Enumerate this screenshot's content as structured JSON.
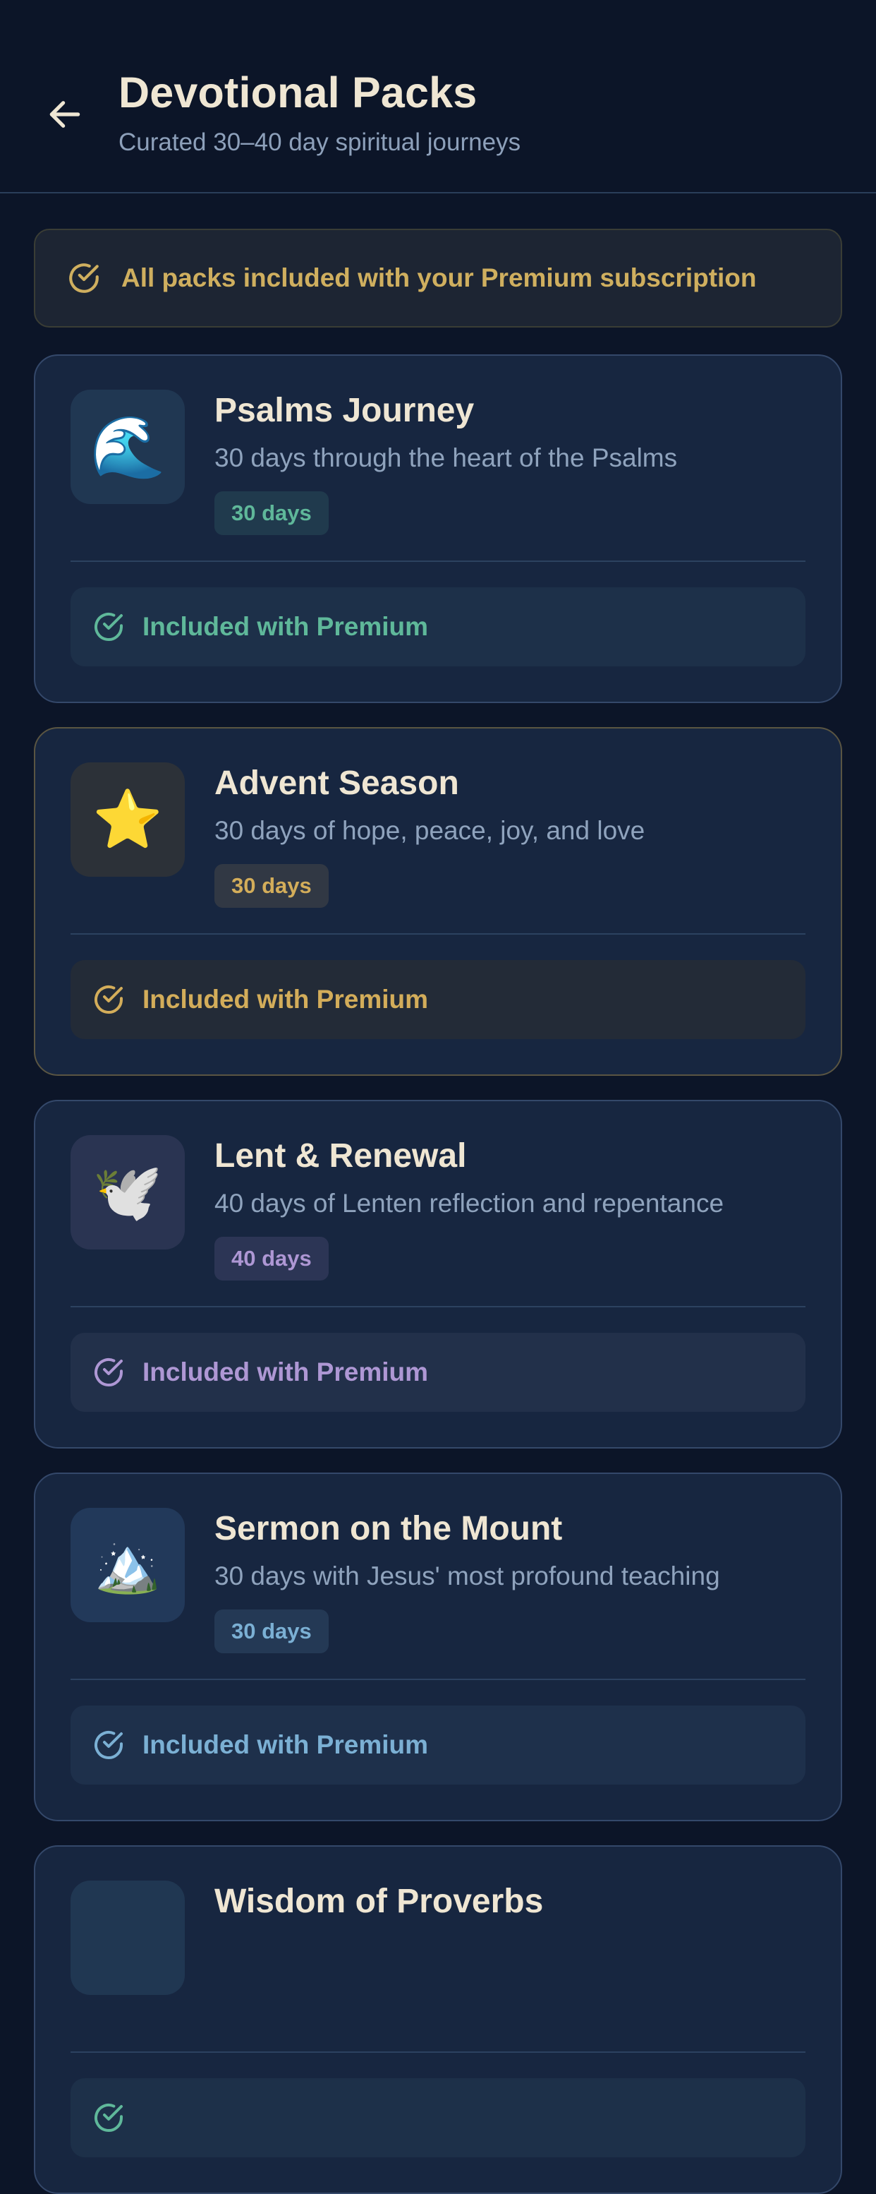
{
  "header": {
    "title": "Devotional Packs",
    "subtitle": "Curated 30–40 day spiritual journeys"
  },
  "banner": {
    "text": "All packs included with your Premium subscription",
    "icon": "check-circle-icon"
  },
  "packs": [
    {
      "title": "Psalms Journey",
      "description": "30 days through the heart of the Psalms",
      "days": "30 days",
      "icon": "wave-icon",
      "emoji": "🌊",
      "status": "Included with Premium",
      "accent": "#5fb89a"
    },
    {
      "title": "Advent Season",
      "description": "30 days of hope, peace, joy, and love",
      "days": "30 days",
      "icon": "star-icon",
      "emoji": "⭐",
      "status": "Included with Premium",
      "accent": "#d3ad5a"
    },
    {
      "title": "Lent & Renewal",
      "description": "40 days of Lenten reflection and repentance",
      "days": "40 days",
      "icon": "dove-icon",
      "emoji": "🕊️",
      "status": "Included with Premium",
      "accent": "#ae97d4"
    },
    {
      "title": "Sermon on the Mount",
      "description": "30 days with Jesus' most profound teaching",
      "days": "30 days",
      "icon": "mountain-icon",
      "emoji": "🏔️",
      "status": "Included with Premium",
      "accent": "#7bb0d4"
    },
    {
      "title": "Wisdom of Proverbs",
      "description": "",
      "days": "",
      "icon": "book-icon",
      "emoji": "",
      "status": "",
      "accent": "#5fb89a"
    }
  ]
}
